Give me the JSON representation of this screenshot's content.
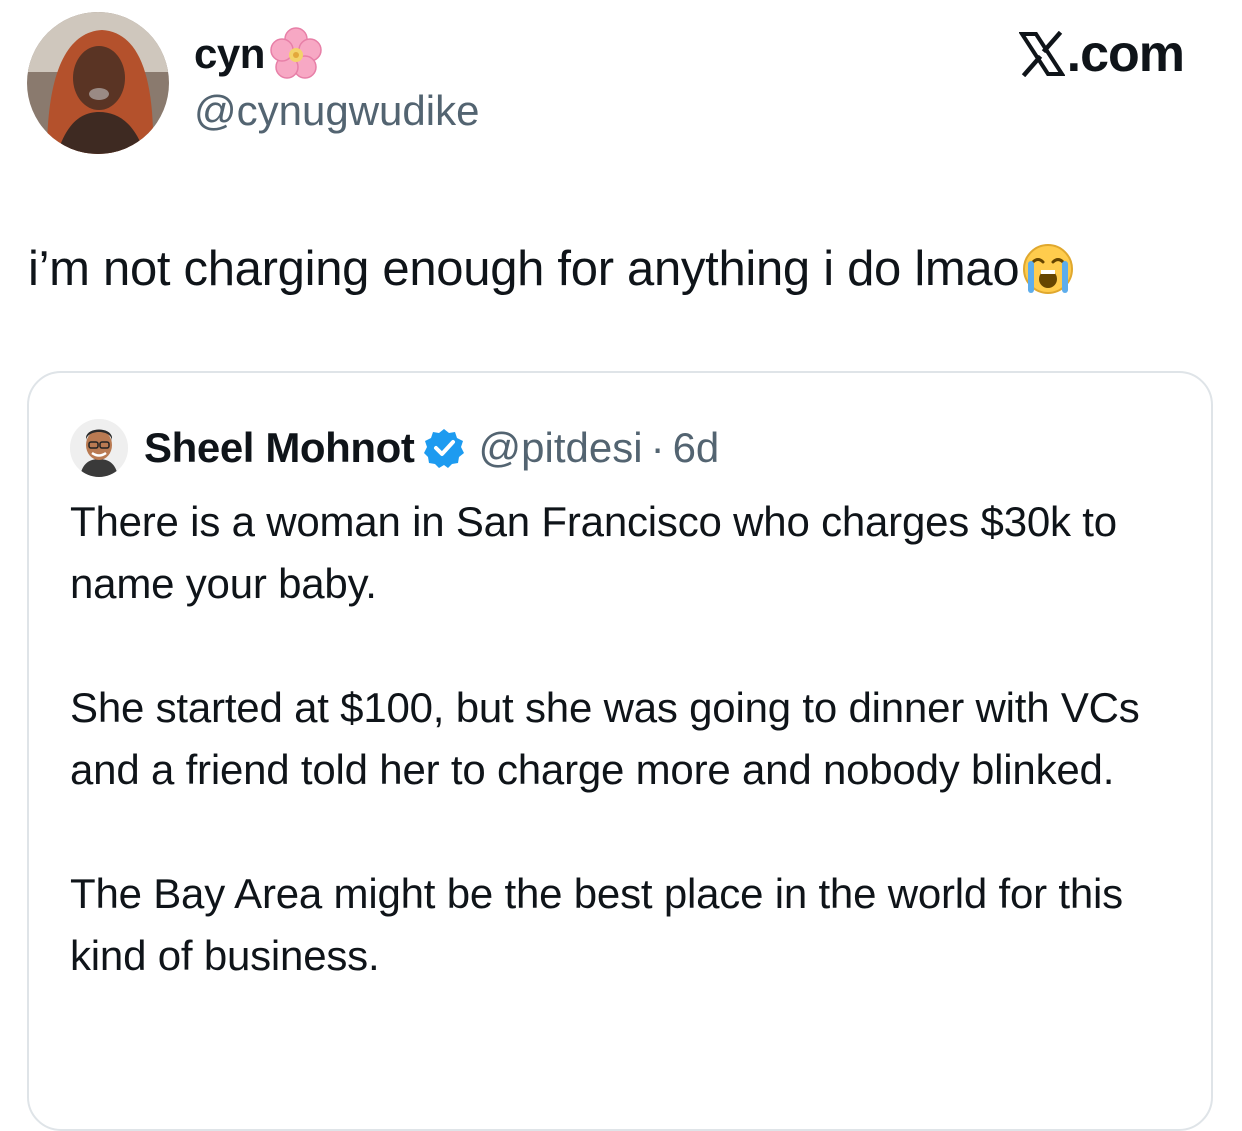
{
  "author": {
    "display_name": "cyn",
    "name_emoji": "cherry-blossom-icon",
    "handle": "@cynugwudike"
  },
  "brand": {
    "text": ".com",
    "logo": "x-logo-icon"
  },
  "tweet": {
    "text": "i’m not charging enough for anything i do lmao",
    "emoji": "loudly-crying-face-icon"
  },
  "quoted": {
    "display_name": "Sheel Mohnot",
    "verified": true,
    "handle": "@pitdesi",
    "separator": "·",
    "time": "6d",
    "paragraphs": [
      "There is a woman in San Francisco who charges $30k to name your baby.",
      "She started at $100, but she was going to dinner with VCs and a friend told her to charge more and nobody blinked.",
      "The Bay Area might be the best place in the world for this kind of business."
    ]
  },
  "colors": {
    "text_primary": "#0f1419",
    "text_secondary": "#536471",
    "verified_blue": "#1d9bf0",
    "card_border": "#dfe4e8"
  }
}
